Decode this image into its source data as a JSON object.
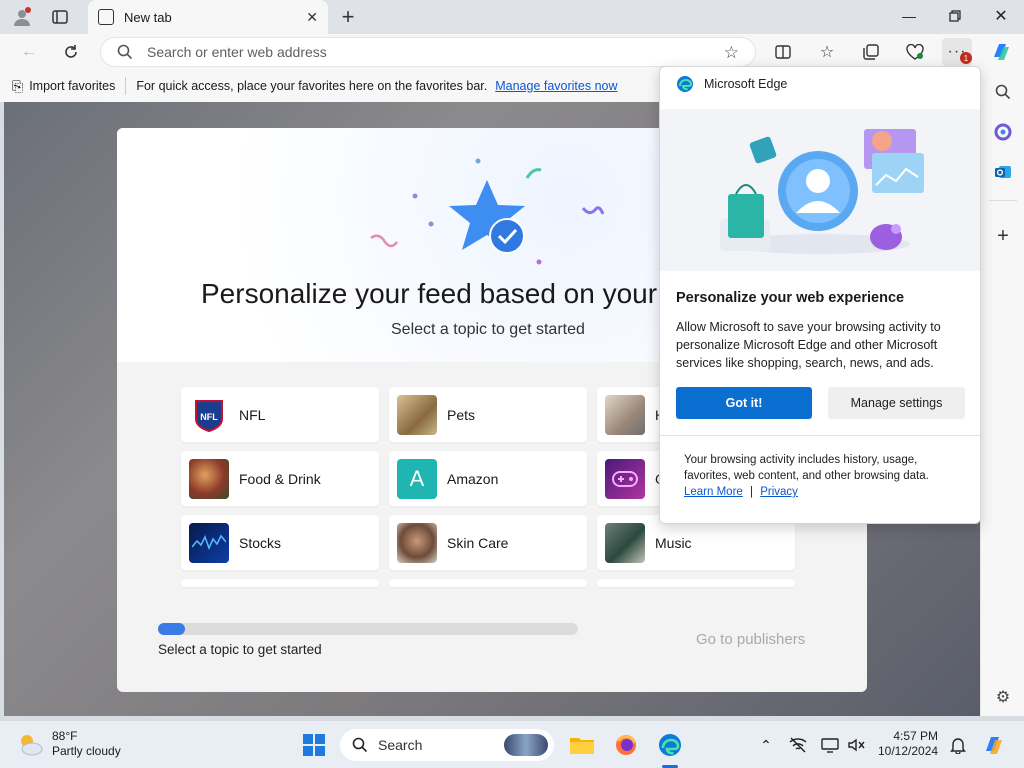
{
  "browser": {
    "tab_title": "New tab",
    "address_placeholder": "Search or enter web address",
    "favorites_bar": {
      "import_label": "Import favorites",
      "message": "For quick access, place your favorites here on the favorites bar.",
      "manage_link": "Manage favorites now"
    },
    "notification_count": "1"
  },
  "feed": {
    "title": "Personalize your feed based on your",
    "subtitle": "Select a topic to get started",
    "topics": [
      {
        "label": "NFL",
        "icon": "nfl-logo"
      },
      {
        "label": "Pets",
        "icon": "pets-photo"
      },
      {
        "label": "H",
        "icon": "health-photo"
      },
      {
        "label": "Food & Drink",
        "icon": "food-photo"
      },
      {
        "label": "Amazon",
        "icon": "amazon-tile"
      },
      {
        "label": "G",
        "icon": "gaming-tile"
      },
      {
        "label": "Stocks",
        "icon": "stocks-tile"
      },
      {
        "label": "Skin Care",
        "icon": "skincare-photo"
      },
      {
        "label": "Music",
        "icon": "music-photo"
      }
    ],
    "amazon_letter": "A",
    "progress_label": "Select a topic to get started",
    "progress_fraction": 0.065,
    "go_publishers": "Go to publishers"
  },
  "popup": {
    "brand": "Microsoft Edge",
    "title": "Personalize your web experience",
    "body": "Allow Microsoft to save your browsing activity to personalize Microsoft Edge and other Microsoft services like shopping, search, news, and ads.",
    "primary_button": "Got it!",
    "secondary_button": "Manage settings",
    "footer_text": "Your browsing activity includes history, usage, favorites, web content, and other browsing data.",
    "learn_more": "Learn More",
    "separator": "|",
    "privacy": "Privacy"
  },
  "taskbar": {
    "weather_temp": "88°F",
    "weather_desc": "Partly cloudy",
    "search_label": "Search",
    "time": "4:57 PM",
    "date": "10/12/2024"
  },
  "colors": {
    "accent": "#0a6fd0",
    "progress": "#3b7be6",
    "link": "#0b57d0"
  }
}
